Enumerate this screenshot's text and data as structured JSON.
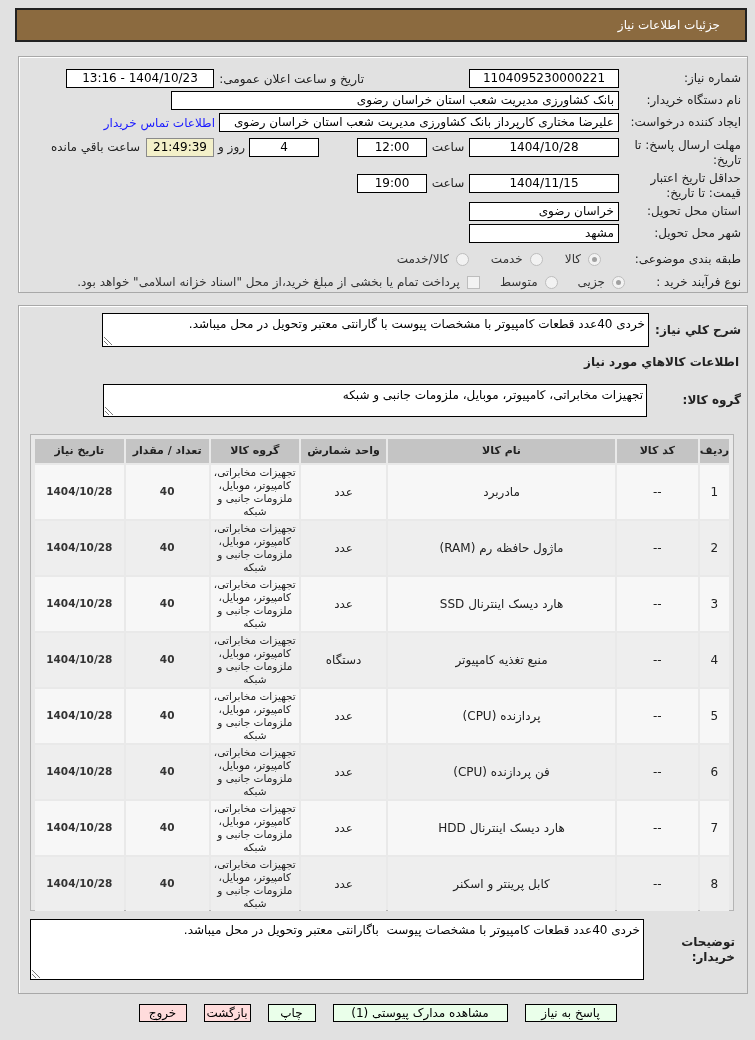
{
  "header": {
    "title": "جزئیات اطلاعات نیاز"
  },
  "need_info": {
    "need_number": {
      "label": "شماره نیاز:",
      "value": "1104095230000221"
    },
    "announce_datetime": {
      "label": "تاریخ و ساعت اعلان عمومی:",
      "value": "1404/10/23 - 13:16"
    },
    "buyer_org": {
      "label": "نام دستگاه خریدار:",
      "value": "بانک کشاورزی مدیریت شعب استان خراسان رضوی"
    },
    "requester": {
      "label": "ایجاد کننده درخواست:",
      "value": "علیرضا مختاری کارپرداز بانک کشاورزی مدیریت شعب استان خراسان رضوی",
      "contact_link": "اطلاعات تماس خریدار"
    },
    "reply_deadline": {
      "label": "مهلت ارسال پاسخ: تا تاریخ:",
      "date": "1404/10/28",
      "time_label": "ساعت",
      "time": "12:00",
      "days": "4",
      "days_label": "روز و",
      "remaining": "21:49:39",
      "remaining_label": "ساعت باقي مانده"
    },
    "price_validity": {
      "label": "حداقل تاریخ اعتبار قیمت: تا تاریخ:",
      "date": "1404/11/15",
      "time_label": "ساعت",
      "time": "19:00"
    },
    "delivery_province": {
      "label": "استان محل تحویل:",
      "value": "خراسان رضوی"
    },
    "delivery_city": {
      "label": "شهر محل تحویل:",
      "value": "مشهد"
    },
    "subject_category": {
      "label": "طبقه بندی موضوعی:",
      "options": [
        {
          "label": "کالا",
          "selected": true
        },
        {
          "label": "خدمت",
          "selected": false
        },
        {
          "label": "کالا/خدمت",
          "selected": false
        }
      ]
    },
    "purchase_process": {
      "label": "نوع فرآیند خرید :",
      "options": [
        {
          "label": "جزیی",
          "selected": true
        },
        {
          "label": "متوسط",
          "selected": false
        }
      ],
      "treasury_payment": {
        "label": "پرداخت تمام یا بخشی از مبلغ خرید،از محل \"اسناد خزانه اسلامی\" خواهد بود.",
        "checked": false
      }
    }
  },
  "need_description": {
    "label": "شرح کلي نياز:",
    "value": "خردی 40عدد قطعات کامپیوتر با مشخصات پیوست با گارانتی معتبر وتحویل در محل میباشد."
  },
  "goods_info": {
    "heading": "اطلاعات کالاهاي مورد نياز",
    "group_label": "گروه کالا:",
    "group_value": "تجهیزات مخابراتی، کامپیوتر، موبایل، ملزومات جانبی و شبکه"
  },
  "table": {
    "columns": [
      "ردیف",
      "کد کالا",
      "نام کالا",
      "واحد شمارش",
      "گروه کالا",
      "تعداد / مقدار",
      "تاریخ نیاز"
    ],
    "rows": [
      {
        "cells": [
          "1",
          "--",
          "مادربرد",
          "عدد",
          "تجهیزات مخابراتی، کامپیوتر، موبایل، ملزومات جانبی و شبکه",
          "40",
          "1404/10/28"
        ]
      },
      {
        "cells": [
          "2",
          "--",
          "ماژول حافظه رم (RAM)",
          "عدد",
          "تجهیزات مخابراتی، کامپیوتر، موبایل، ملزومات جانبی و شبکه",
          "40",
          "1404/10/28"
        ]
      },
      {
        "cells": [
          "3",
          "--",
          "هارد دیسک اینترنال SSD",
          "عدد",
          "تجهیزات مخابراتی، کامپیوتر، موبایل، ملزومات جانبی و شبکه",
          "40",
          "1404/10/28"
        ]
      },
      {
        "cells": [
          "4",
          "--",
          "منبع تغذیه کامپیوتر",
          "دستگاه",
          "تجهیزات مخابراتی، کامپیوتر، موبایل، ملزومات جانبی و شبکه",
          "40",
          "1404/10/28"
        ]
      },
      {
        "cells": [
          "5",
          "--",
          "پردازنده (CPU)",
          "عدد",
          "تجهیزات مخابراتی، کامپیوتر، موبایل، ملزومات جانبی و شبکه",
          "40",
          "1404/10/28"
        ]
      },
      {
        "cells": [
          "6",
          "--",
          "فن پردازنده (CPU)",
          "عدد",
          "تجهیزات مخابراتی، کامپیوتر، موبایل، ملزومات جانبی و شبکه",
          "40",
          "1404/10/28"
        ]
      },
      {
        "cells": [
          "7",
          "--",
          "هارد دیسک اینترنال HDD",
          "عدد",
          "تجهیزات مخابراتی، کامپیوتر، موبایل، ملزومات جانبی و شبکه",
          "40",
          "1404/10/28"
        ]
      },
      {
        "cells": [
          "8",
          "--",
          "کابل پرینتر و اسکنر",
          "عدد",
          "تجهیزات مخابراتی، کامپیوتر، موبایل، ملزومات جانبی و شبکه",
          "40",
          "1404/10/28"
        ]
      }
    ]
  },
  "buyer_notes": {
    "label": "توضیحات خریدار:",
    "value": "خردی 40عدد قطعات کامپیوتر با مشخصات پیوست  باگارانتی معتبر وتحویل در محل میباشد."
  },
  "buttons": [
    {
      "label": "پاسخ به نیاز",
      "kind": "proceed"
    },
    {
      "label": "مشاهده مدارک پیوستی (1)",
      "kind": "proceed"
    },
    {
      "label": "چاپ",
      "kind": "proceed"
    },
    {
      "label": "بازگشت",
      "kind": "leave"
    },
    {
      "label": "خروج",
      "kind": "leave"
    }
  ]
}
